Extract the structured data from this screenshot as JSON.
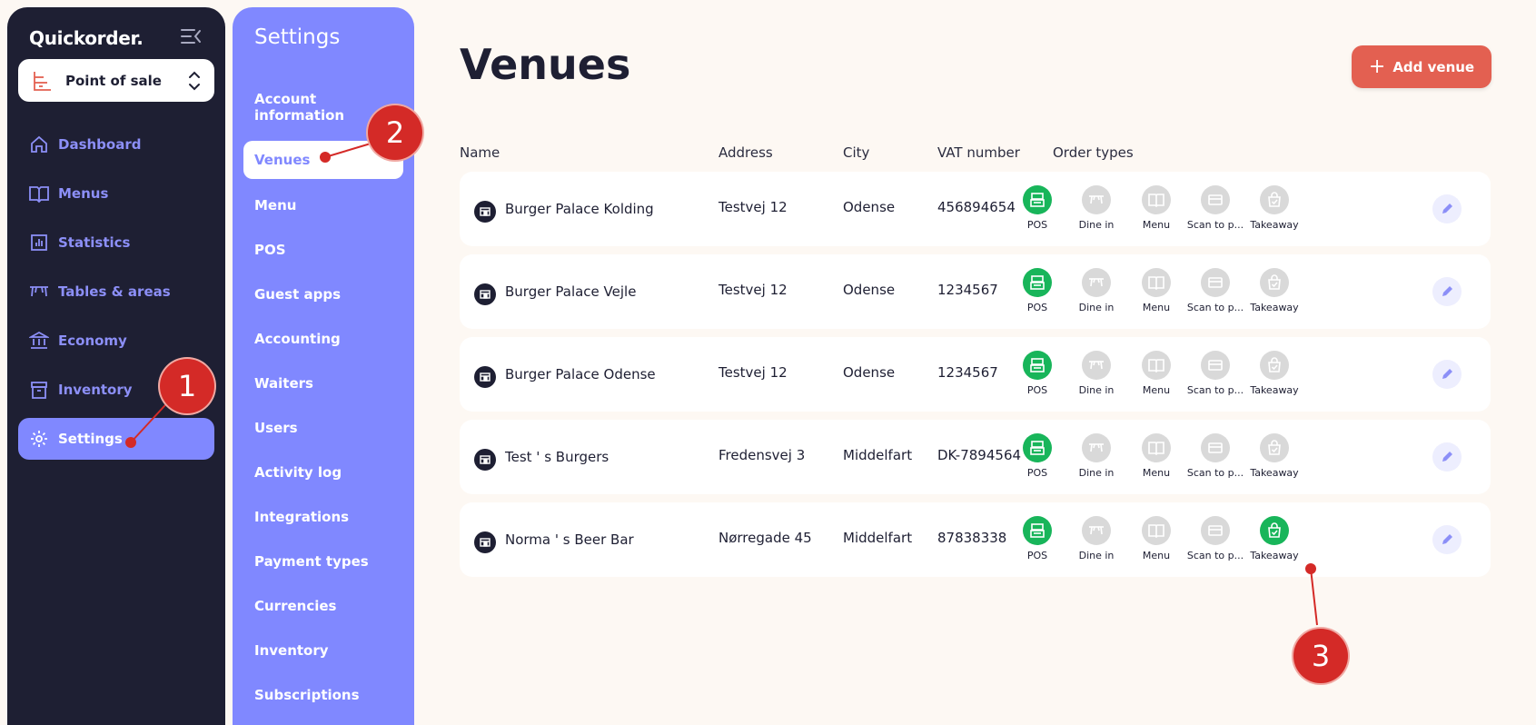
{
  "app": {
    "logo": "Quickorder."
  },
  "selector": {
    "label": "Point of sale"
  },
  "nav": [
    {
      "label": "Dashboard",
      "icon": "home-icon"
    },
    {
      "label": "Menus",
      "icon": "book-icon"
    },
    {
      "label": "Statistics",
      "icon": "chart-icon"
    },
    {
      "label": "Tables & areas",
      "icon": "table-icon"
    },
    {
      "label": "Economy",
      "icon": "bank-icon"
    },
    {
      "label": "Inventory",
      "icon": "archive-icon"
    },
    {
      "label": "Settings",
      "icon": "gear-icon",
      "active": true
    }
  ],
  "settings": {
    "title": "Settings",
    "items": [
      "Account information",
      "Venues",
      "Menu",
      "POS",
      "Guest apps",
      "Accounting",
      "Waiters",
      "Users",
      "Activity log",
      "Integrations",
      "Payment types",
      "Currencies",
      "Inventory",
      "Subscriptions"
    ],
    "active": "Venues"
  },
  "page": {
    "title": "Venues",
    "add_button": "Add venue"
  },
  "table": {
    "headers": [
      "Name",
      "Address",
      "City",
      "VAT number",
      "Order types"
    ],
    "order_type_labels": [
      "POS",
      "Dine in",
      "Menu",
      "Scan to p...",
      "Takeaway"
    ],
    "rows": [
      {
        "name": "Burger Palace Kolding",
        "address": "Testvej 12",
        "city": "Odense",
        "vat": "456894654",
        "enabled": [
          true,
          false,
          false,
          false,
          false
        ]
      },
      {
        "name": "Burger Palace Vejle",
        "address": "Testvej 12",
        "city": "Odense",
        "vat": "1234567",
        "enabled": [
          true,
          false,
          false,
          false,
          false
        ]
      },
      {
        "name": "Burger Palace Odense",
        "address": "Testvej 12",
        "city": "Odense",
        "vat": "1234567",
        "enabled": [
          true,
          false,
          false,
          false,
          false
        ]
      },
      {
        "name": "Test ' s Burgers",
        "address": "Fredensvej 3",
        "city": "Middelfart",
        "vat": "DK-7894564",
        "enabled": [
          true,
          false,
          false,
          false,
          false
        ]
      },
      {
        "name": "Norma ' s Beer Bar",
        "address": "Nørregade 45",
        "city": "Middelfart",
        "vat": "87838338",
        "enabled": [
          true,
          false,
          false,
          false,
          true
        ]
      }
    ]
  },
  "annotations": [
    "1",
    "2",
    "3"
  ],
  "colors": {
    "sidebar": "#1e1f33",
    "accent": "#8088ff",
    "primary_button": "#e36051",
    "enabled": "#18b55a",
    "disabled": "#d9d9d9",
    "marker": "#d42a27"
  }
}
